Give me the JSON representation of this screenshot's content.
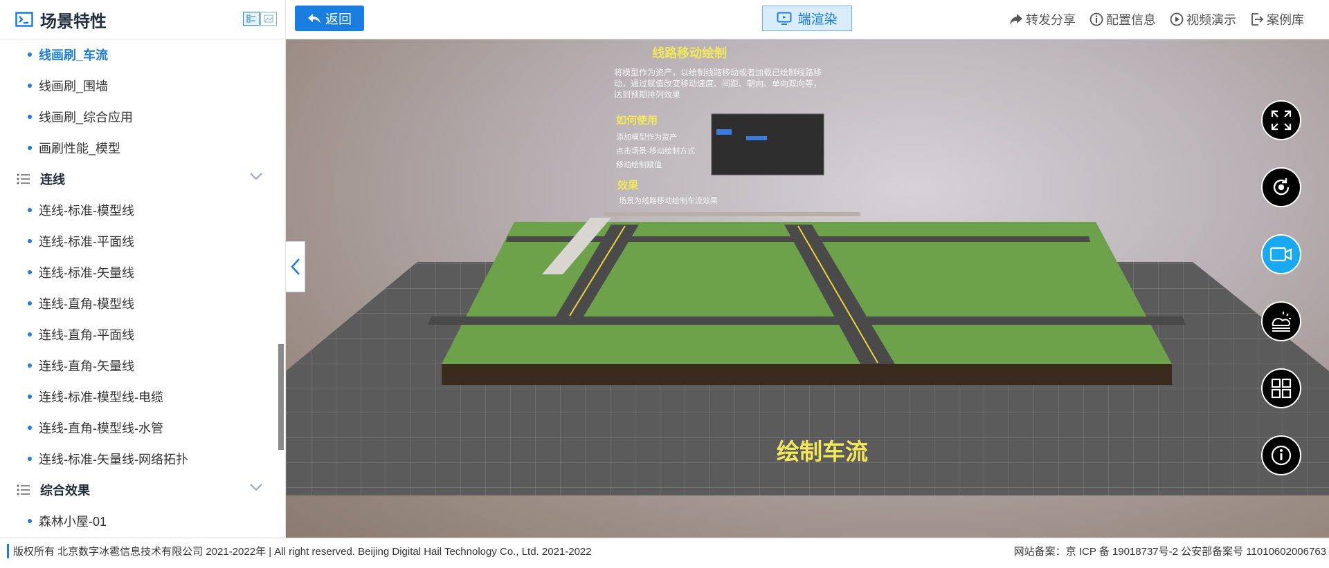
{
  "sidebar": {
    "title": "场景特性",
    "items_top": [
      {
        "label": "线画刷_车流",
        "active": true
      },
      {
        "label": "线画刷_围墙"
      },
      {
        "label": "线画刷_综合应用"
      },
      {
        "label": "画刷性能_模型"
      }
    ],
    "group1": "连线",
    "items_group1": [
      {
        "label": "连线-标准-模型线"
      },
      {
        "label": "连线-标准-平面线"
      },
      {
        "label": "连线-标准-矢量线"
      },
      {
        "label": "连线-直角-模型线"
      },
      {
        "label": "连线-直角-平面线"
      },
      {
        "label": "连线-直角-矢量线"
      },
      {
        "label": "连线-标准-模型线-电缆"
      },
      {
        "label": "连线-直角-模型线-水管"
      },
      {
        "label": "连线-标准-矢量线-网络拓扑"
      }
    ],
    "group2": "综合效果",
    "items_group2": [
      {
        "label": "森林小屋-01"
      }
    ]
  },
  "topbar": {
    "back_label": "返回",
    "render_label": "端渲染",
    "share_label": "转发分享",
    "config_label": "配置信息",
    "video_label": "视频演示",
    "library_label": "案例库"
  },
  "scene": {
    "panel_title": "线路移动绘制",
    "panel_desc_1": "将模型作为资产，以绘制线路移动或者加载已绘制线路移",
    "panel_desc_2": "动，通过赋值改变移动速度、间距、朝向、单向双向等，",
    "panel_desc_3": "达到预期排列效果",
    "howto_title": "如何使用",
    "howto_1": "添加模型作为资产",
    "howto_2": "点击场景-移动绘制方式",
    "howto_3": "移动绘制赋值",
    "effect_title": "效果",
    "effect_1": "场景为线路移动绘制车流效果",
    "caption": "绘制车流"
  },
  "tools": [
    "fullscreen-icon",
    "refresh-icon",
    "camera-icon",
    "weather-icon",
    "grid-icon",
    "info-icon"
  ],
  "footer": {
    "left": "版权所有 北京数字冰雹信息技术有限公司 2021-2022年 | All right reserved. Beijing Digital Hail Technology Co., Ltd. 2021-2022",
    "right": "网站备案：京 ICP 备 19018737号-2 公安部备案号 11010602006763"
  },
  "colors": {
    "accent": "#1a7de0",
    "active_tool": "#18a9f0",
    "grass": "#6ea24a"
  }
}
